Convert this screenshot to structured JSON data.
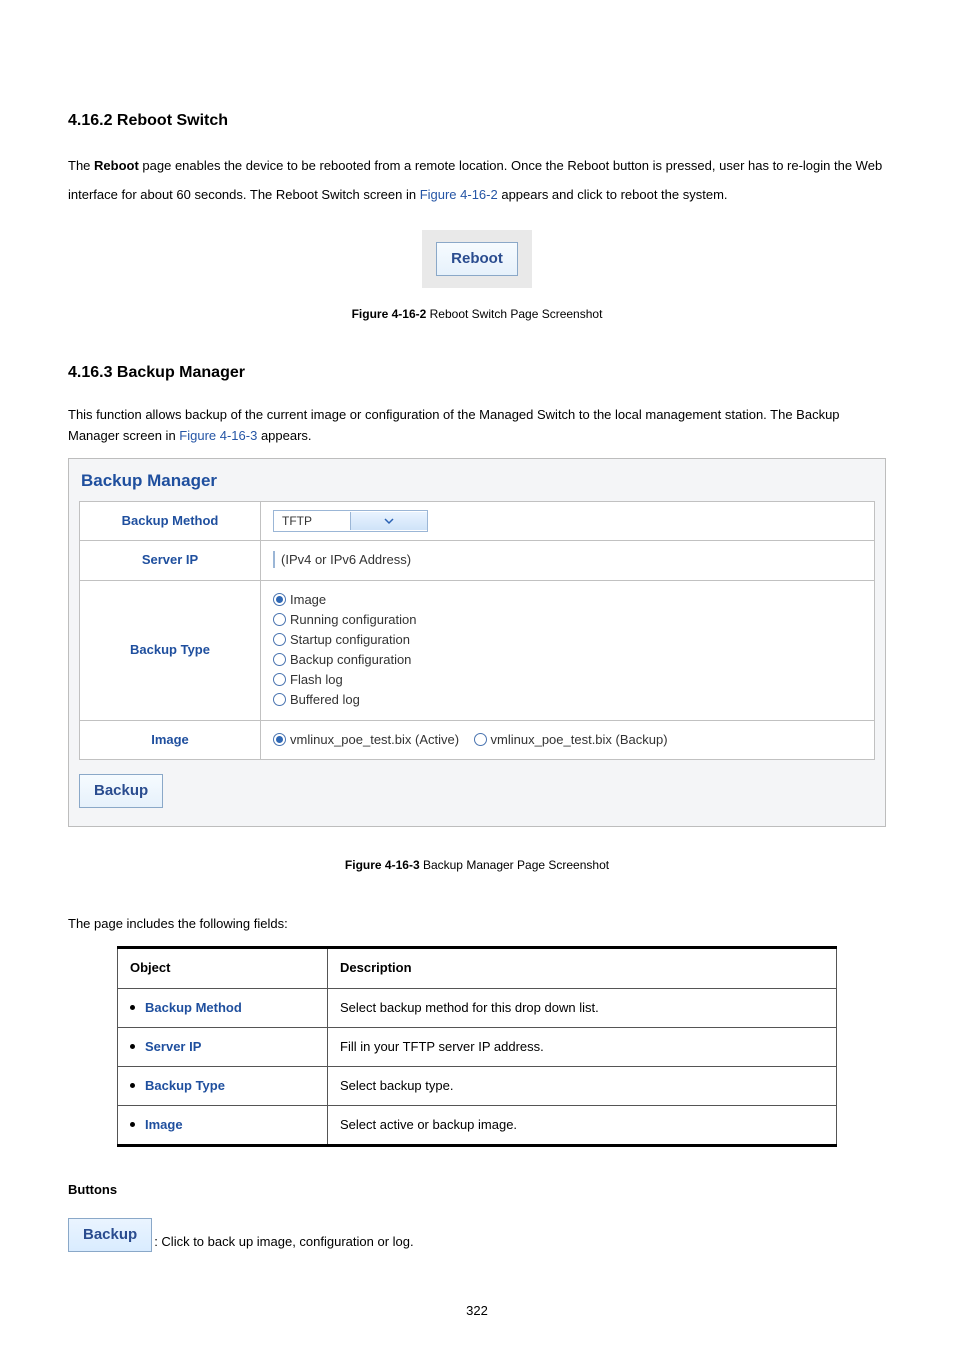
{
  "section1": {
    "heading": "4.16.2 Reboot Switch",
    "para_pre": "The ",
    "para_bold": "Reboot",
    "para_mid": " page enables the device to be rebooted from a remote location. Once the Reboot button is pressed, user has to re-login the Web interface for about 60 seconds. The Reboot Switch screen in ",
    "para_link": "Figure 4-16-2",
    "para_post": " appears and click to reboot the system.",
    "button": "Reboot",
    "caption_b": "Figure 4-16-2",
    "caption_rest": " Reboot Switch Page Screenshot"
  },
  "section2": {
    "heading": "4.16.3 Backup Manager",
    "para_pre": "This function allows backup of the current image or configuration of the Managed Switch to the local management station. The Backup Manager screen in ",
    "para_link": "Figure 4-16-3",
    "para_post": " appears.",
    "panel_title": "Backup Manager",
    "rows": {
      "method_k": "Backup Method",
      "method_v": "TFTP",
      "server_k": "Server IP",
      "server_note": "(IPv4 or IPv6 Address)",
      "type_k": "Backup Type",
      "type_opts": [
        "Image",
        "Running configuration",
        "Startup configuration",
        "Backup configuration",
        "Flash log",
        "Buffered log"
      ],
      "image_k": "Image",
      "image_opts": [
        "vmlinux_poe_test.bix (Active)",
        "vmlinux_poe_test.bix (Backup)"
      ]
    },
    "backup_btn": "Backup",
    "caption_b": "Figure 4-16-3",
    "caption_rest": " Backup Manager Page Screenshot"
  },
  "fields_intro": "The page includes the following fields:",
  "fields_headers": {
    "obj": "Object",
    "desc": "Description"
  },
  "fields": [
    {
      "obj": "Backup Method",
      "desc": "Select backup method for this drop down list."
    },
    {
      "obj": "Server IP",
      "desc": "Fill in your TFTP server IP address."
    },
    {
      "obj": "Backup Type",
      "desc": "Select backup type."
    },
    {
      "obj": "Image",
      "desc": "Select active or backup image."
    }
  ],
  "buttons_h": "Buttons",
  "buttons_desc": ": Click to back up image, configuration or log.",
  "page_number": "322"
}
